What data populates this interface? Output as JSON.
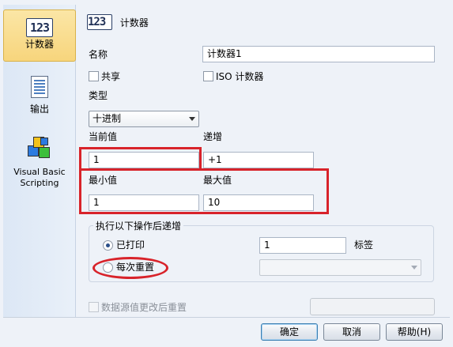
{
  "nav": {
    "items": [
      {
        "label": "计数器",
        "icon": "counter-123-icon",
        "icon_text": "123"
      },
      {
        "label": "输出",
        "icon": "output-document-icon"
      },
      {
        "label": "Visual Basic\nScripting",
        "icon": "vb-scripting-cubes-icon"
      }
    ]
  },
  "header": {
    "icon_text": "123",
    "title": "计数器"
  },
  "form": {
    "name_label": "名称",
    "name_value": "计数器1",
    "shared_label": "共享",
    "iso_label": "ISO 计数器",
    "type_label": "类型",
    "type_value": "十进制",
    "current_label": "当前值",
    "current_value": "1",
    "increment_label": "递增",
    "increment_value": "+1",
    "min_label": "最小值",
    "min_value": "1",
    "max_label": "最大值",
    "max_value": "10"
  },
  "group": {
    "title": "执行以下操作后递增",
    "printed_label": "已打印",
    "printed_value": "1",
    "tag_label": "标签",
    "reset_label": "每次重置"
  },
  "footer": {
    "datasource_label": "数据源值更改后重置",
    "ok_label": "确定",
    "cancel_label": "取消",
    "help_label": "帮助(H)"
  },
  "colors": {
    "highlight_red": "#d8232a",
    "selected_nav": "#f7d57c",
    "background": "#eef2f8"
  }
}
